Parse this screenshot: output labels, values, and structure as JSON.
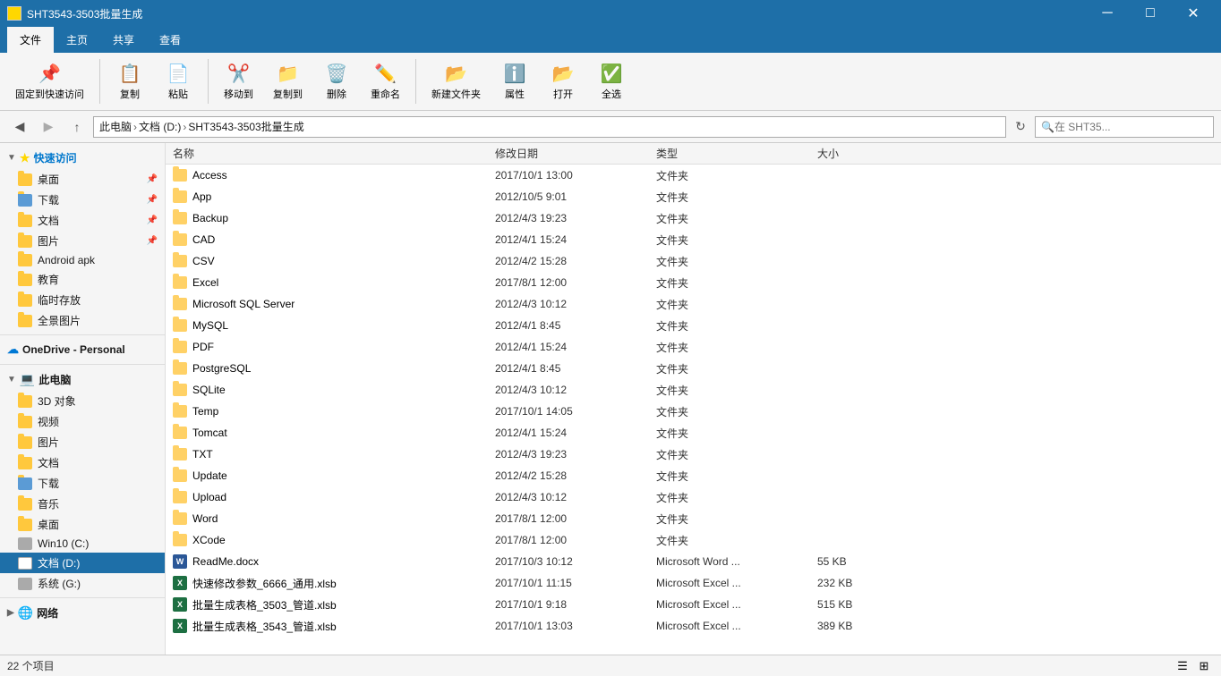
{
  "titleBar": {
    "title": "SHT3543-3503批量生成",
    "minBtn": "─",
    "maxBtn": "□",
    "closeBtn": "✕"
  },
  "ribbon": {
    "tabs": [
      "文件",
      "主页",
      "共享",
      "查看"
    ],
    "activeTab": "主页"
  },
  "addressBar": {
    "back": "←",
    "forward": "→",
    "up": "↑",
    "pathParts": [
      "此电脑",
      "文档 (D:)",
      "SHT3543-3503批量生成"
    ],
    "searchPlaceholder": "在 SHT35...",
    "searchValue": ""
  },
  "sidebar": {
    "quickAccessLabel": "快速访问",
    "items": [
      {
        "label": "桌面",
        "pin": true,
        "type": "folder"
      },
      {
        "label": "下载",
        "pin": true,
        "type": "folder"
      },
      {
        "label": "文档",
        "pin": true,
        "type": "folder"
      },
      {
        "label": "图片",
        "pin": true,
        "type": "folder"
      },
      {
        "label": "Android apk",
        "pin": false,
        "type": "folder"
      },
      {
        "label": "教育",
        "pin": false,
        "type": "folder"
      },
      {
        "label": "临时存放",
        "pin": false,
        "type": "folder"
      },
      {
        "label": "全景图片",
        "pin": false,
        "type": "folder"
      }
    ],
    "oneDriveLabel": "OneDrive - Personal",
    "thisPcLabel": "此电脑",
    "thisPcItems": [
      {
        "label": "3D 对象",
        "type": "folder"
      },
      {
        "label": "视频",
        "type": "folder"
      },
      {
        "label": "图片",
        "type": "folder"
      },
      {
        "label": "文档",
        "type": "folder"
      },
      {
        "label": "下载",
        "type": "folder"
      },
      {
        "label": "音乐",
        "type": "folder"
      },
      {
        "label": "桌面",
        "type": "folder"
      },
      {
        "label": "Win10 (C:)",
        "type": "drive"
      },
      {
        "label": "文档 (D:)",
        "type": "drive",
        "selected": true
      },
      {
        "label": "系统 (G:)",
        "type": "drive"
      }
    ],
    "networkLabel": "网络"
  },
  "fileList": {
    "columns": [
      "名称",
      "修改日期",
      "类型",
      "大小"
    ],
    "sortCol": "名称",
    "sortDir": "asc",
    "rows": [
      {
        "name": "Access",
        "date": "2017/10/1 13:00",
        "type": "文件夹",
        "size": "",
        "icon": "folder"
      },
      {
        "name": "App",
        "date": "2012/10/5 9:01",
        "type": "文件夹",
        "size": "",
        "icon": "folder"
      },
      {
        "name": "Backup",
        "date": "2012/4/3 19:23",
        "type": "文件夹",
        "size": "",
        "icon": "folder"
      },
      {
        "name": "CAD",
        "date": "2012/4/1 15:24",
        "type": "文件夹",
        "size": "",
        "icon": "folder"
      },
      {
        "name": "CSV",
        "date": "2012/4/2 15:28",
        "type": "文件夹",
        "size": "",
        "icon": "folder"
      },
      {
        "name": "Excel",
        "date": "2017/8/1 12:00",
        "type": "文件夹",
        "size": "",
        "icon": "folder"
      },
      {
        "name": "Microsoft SQL Server",
        "date": "2012/4/3 10:12",
        "type": "文件夹",
        "size": "",
        "icon": "folder"
      },
      {
        "name": "MySQL",
        "date": "2012/4/1 8:45",
        "type": "文件夹",
        "size": "",
        "icon": "folder"
      },
      {
        "name": "PDF",
        "date": "2012/4/1 15:24",
        "type": "文件夹",
        "size": "",
        "icon": "folder"
      },
      {
        "name": "PostgreSQL",
        "date": "2012/4/1 8:45",
        "type": "文件夹",
        "size": "",
        "icon": "folder"
      },
      {
        "name": "SQLite",
        "date": "2012/4/3 10:12",
        "type": "文件夹",
        "size": "",
        "icon": "folder"
      },
      {
        "name": "Temp",
        "date": "2017/10/1 14:05",
        "type": "文件夹",
        "size": "",
        "icon": "folder"
      },
      {
        "name": "Tomcat",
        "date": "2012/4/1 15:24",
        "type": "文件夹",
        "size": "",
        "icon": "folder"
      },
      {
        "name": "TXT",
        "date": "2012/4/3 19:23",
        "type": "文件夹",
        "size": "",
        "icon": "folder"
      },
      {
        "name": "Update",
        "date": "2012/4/2 15:28",
        "type": "文件夹",
        "size": "",
        "icon": "folder"
      },
      {
        "name": "Upload",
        "date": "2012/4/3 10:12",
        "type": "文件夹",
        "size": "",
        "icon": "folder"
      },
      {
        "name": "Word",
        "date": "2017/8/1 12:00",
        "type": "文件夹",
        "size": "",
        "icon": "folder"
      },
      {
        "name": "XCode",
        "date": "2017/8/1 12:00",
        "type": "文件夹",
        "size": "",
        "icon": "folder"
      },
      {
        "name": "ReadMe.docx",
        "date": "2017/10/3 10:12",
        "type": "Microsoft Word ...",
        "size": "55 KB",
        "icon": "word"
      },
      {
        "name": "快速修改参数_6666_通用.xlsb",
        "date": "2017/10/1 11:15",
        "type": "Microsoft Excel ...",
        "size": "232 KB",
        "icon": "excel"
      },
      {
        "name": "批量生成表格_3503_管道.xlsb",
        "date": "2017/10/1 9:18",
        "type": "Microsoft Excel ...",
        "size": "515 KB",
        "icon": "excel"
      },
      {
        "name": "批量生成表格_3543_管道.xlsb",
        "date": "2017/10/1 13:03",
        "type": "Microsoft Excel ...",
        "size": "389 KB",
        "icon": "excel"
      }
    ]
  },
  "statusBar": {
    "itemCount": "22 个项目"
  }
}
